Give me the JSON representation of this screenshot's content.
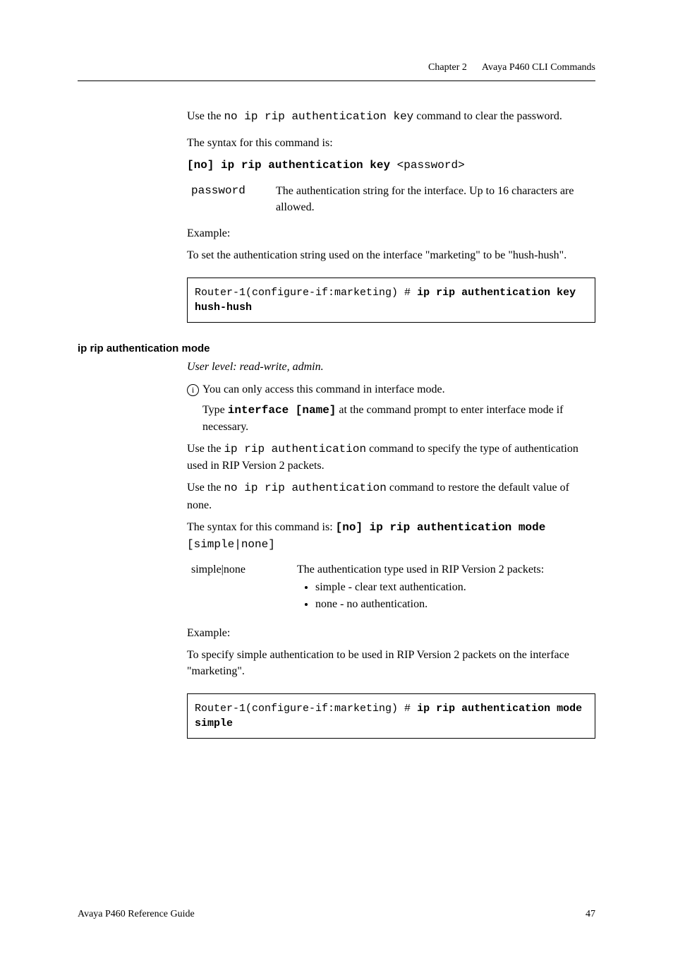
{
  "header": {
    "chapter": "Chapter 2",
    "title": "Avaya P460 CLI Commands"
  },
  "section1": {
    "p1_a": "Use the ",
    "p1_code": "no ip rip authentication key",
    "p1_b": " command to clear the password.",
    "p2": "The syntax for this command is:",
    "syntax_bold": "[no] ip rip authentication key",
    "syntax_arg": " <password>",
    "param_name": "password",
    "param_desc": "The authentication string for the interface. Up to 16 characters are allowed.",
    "example_label": "Example:",
    "example_desc": "To set the authentication string used on the interface \"marketing\" to be \"hush-hush\".",
    "code_prefix": "Router-1(configure-if:marketing) # ",
    "code_bold": "ip rip authentication key hush-hush"
  },
  "section2": {
    "heading": "ip rip authentication mode",
    "user_level": "User level: read-write, admin.",
    "note1": "You can only access this command in interface mode.",
    "note2_a": "Type ",
    "note2_code": "interface [name]",
    "note2_b": " at the command prompt to enter interface mode if necessary.",
    "p1_a": "Use the ",
    "p1_code": "ip rip authentication",
    "p1_b": " command to specify the type of authentication used in RIP Version 2 packets.",
    "p2_a": "Use the ",
    "p2_code": "no ip rip authentication",
    "p2_b": " command to restore the default value of none.",
    "p3_a": "The syntax for this command is:  ",
    "p3_bold": "[no] ip rip authentication mode",
    "p3_arg": "[simple|none]",
    "param_name": "simple|none",
    "param_desc_lead": "The authentication type used in RIP Version 2 packets:",
    "bullet1": "simple - clear text authentication.",
    "bullet2": "none - no authentication.",
    "example_label": "Example:",
    "example_desc": "To specify simple authentication to be used in RIP Version 2 packets on the interface \"marketing\".",
    "code_prefix": "Router-1(configure-if:marketing) # ",
    "code_bold": "ip rip authentication mode simple"
  },
  "footer": {
    "left": "Avaya P460 Reference Guide",
    "right": "47"
  }
}
